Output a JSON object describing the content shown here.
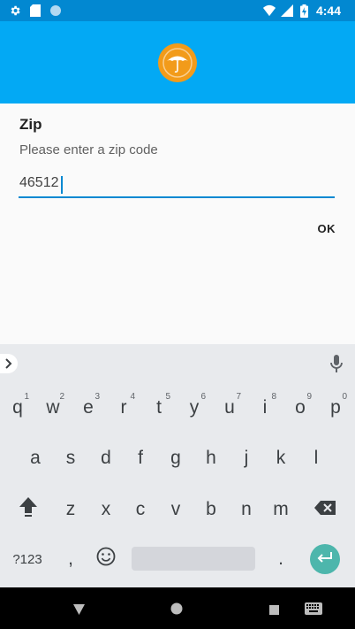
{
  "status_bar": {
    "time": "4:44"
  },
  "dialog": {
    "title": "Zip",
    "message": "Please enter a zip code",
    "input_value": "46512",
    "ok_label": "OK"
  },
  "keyboard": {
    "row1": [
      {
        "label": "q",
        "hint": "1"
      },
      {
        "label": "w",
        "hint": "2"
      },
      {
        "label": "e",
        "hint": "3"
      },
      {
        "label": "r",
        "hint": "4"
      },
      {
        "label": "t",
        "hint": "5"
      },
      {
        "label": "y",
        "hint": "6"
      },
      {
        "label": "u",
        "hint": "7"
      },
      {
        "label": "i",
        "hint": "8"
      },
      {
        "label": "o",
        "hint": "9"
      },
      {
        "label": "p",
        "hint": "0"
      }
    ],
    "row2": [
      "a",
      "s",
      "d",
      "f",
      "g",
      "h",
      "j",
      "k",
      "l"
    ],
    "row3": [
      "z",
      "x",
      "c",
      "v",
      "b",
      "n",
      "m"
    ],
    "symbols_label": "?123",
    "comma_label": ",",
    "period_label": "."
  },
  "colors": {
    "status_bar": "#0288d1",
    "app_bar": "#03a9f4",
    "accent": "#0288d1",
    "enter_key": "#4db6ac",
    "logo": "#f29b1a"
  }
}
